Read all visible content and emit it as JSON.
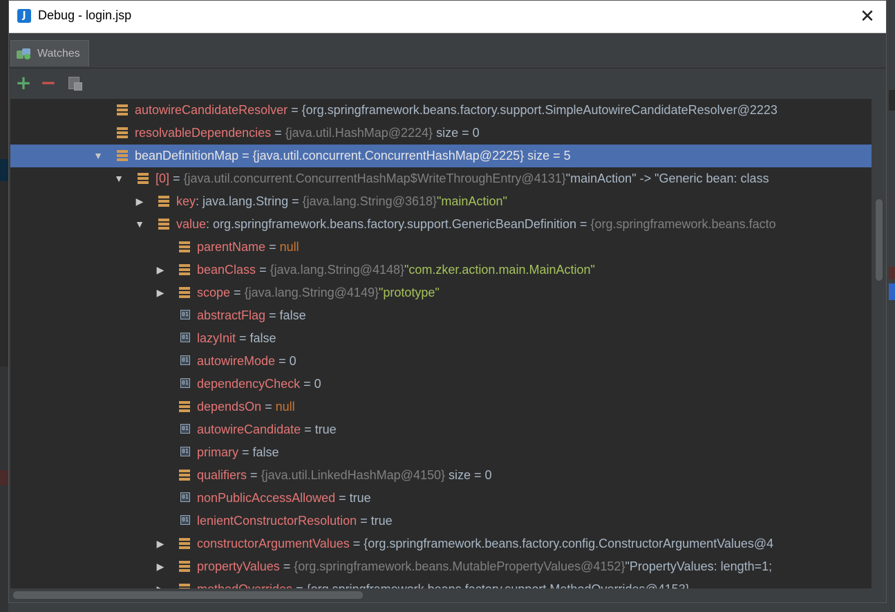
{
  "window": {
    "title": "Debug - login.jsp",
    "app_icon": "J",
    "close_glyph": "✕"
  },
  "tab": {
    "label": "Watches"
  },
  "toolbar": {
    "add": "+",
    "remove": "−"
  },
  "accent": "#4b6eaf",
  "rows": [
    {
      "indent": 0,
      "arrow": "",
      "icon": "field",
      "name": "autowireCandidateResolver",
      "parts": [
        {
          "c": "t",
          "text": " = "
        },
        {
          "c": "t",
          "text": "{org.springframework.beans.factory.support.SimpleAutowireCandidateResolver@2223"
        }
      ]
    },
    {
      "indent": 0,
      "arrow": "",
      "icon": "field",
      "name": "resolvableDependencies",
      "parts": [
        {
          "c": "t",
          "text": " = "
        },
        {
          "c": "g",
          "text": "{java.util.HashMap@2224}"
        },
        {
          "c": "t",
          "text": " size = 0"
        }
      ]
    },
    {
      "indent": 0,
      "arrow": "▼",
      "icon": "field",
      "selected": true,
      "name": "beanDefinitionMap",
      "parts": [
        {
          "c": "t",
          "text": " = "
        },
        {
          "c": "t",
          "text": "{java.util.concurrent.ConcurrentHashMap@2225}"
        },
        {
          "c": "t",
          "text": " size = 5"
        }
      ]
    },
    {
      "indent": 1,
      "arrow": "▼",
      "icon": "field",
      "name": "[0]",
      "parts": [
        {
          "c": "t",
          "text": " = "
        },
        {
          "c": "g",
          "text": "{java.util.concurrent.ConcurrentHashMap$WriteThroughEntry@4131}"
        },
        {
          "c": "t",
          "text": "\"mainAction\" -> \"Generic bean: class"
        }
      ]
    },
    {
      "indent": 2,
      "arrow": "▶",
      "icon": "field",
      "name": "key",
      "parts": [
        {
          "c": "t",
          "text": ": java.lang.String = "
        },
        {
          "c": "g",
          "text": "{java.lang.String@3618}"
        },
        {
          "c": "s",
          "text": "\"mainAction\""
        }
      ]
    },
    {
      "indent": 2,
      "arrow": "▼",
      "icon": "field",
      "name": "value",
      "parts": [
        {
          "c": "t",
          "text": ": org.springframework.beans.factory.support.GenericBeanDefinition = "
        },
        {
          "c": "g",
          "text": "{org.springframework.beans.facto"
        }
      ]
    },
    {
      "indent": 3,
      "arrow": "",
      "icon": "field",
      "name": "parentName",
      "parts": [
        {
          "c": "t",
          "text": " = "
        },
        {
          "c": "k",
          "text": "null"
        }
      ]
    },
    {
      "indent": 3,
      "arrow": "▶",
      "icon": "field",
      "name": "beanClass",
      "parts": [
        {
          "c": "t",
          "text": " = "
        },
        {
          "c": "g",
          "text": "{java.lang.String@4148}"
        },
        {
          "c": "s",
          "text": "\"com.zker.action.main.MainAction\""
        }
      ]
    },
    {
      "indent": 3,
      "arrow": "▶",
      "icon": "field",
      "name": "scope",
      "parts": [
        {
          "c": "t",
          "text": " = "
        },
        {
          "c": "g",
          "text": "{java.lang.String@4149}"
        },
        {
          "c": "s",
          "text": "\"prototype\""
        }
      ]
    },
    {
      "indent": 3,
      "arrow": "",
      "icon": "prim",
      "name": "abstractFlag",
      "parts": [
        {
          "c": "t",
          "text": " = false"
        }
      ]
    },
    {
      "indent": 3,
      "arrow": "",
      "icon": "prim",
      "name": "lazyInit",
      "parts": [
        {
          "c": "t",
          "text": " = false"
        }
      ]
    },
    {
      "indent": 3,
      "arrow": "",
      "icon": "prim",
      "name": "autowireMode",
      "parts": [
        {
          "c": "t",
          "text": " = 0"
        }
      ]
    },
    {
      "indent": 3,
      "arrow": "",
      "icon": "prim",
      "name": "dependencyCheck",
      "parts": [
        {
          "c": "t",
          "text": " = 0"
        }
      ]
    },
    {
      "indent": 3,
      "arrow": "",
      "icon": "field",
      "name": "dependsOn",
      "parts": [
        {
          "c": "t",
          "text": " = "
        },
        {
          "c": "k",
          "text": "null"
        }
      ]
    },
    {
      "indent": 3,
      "arrow": "",
      "icon": "prim",
      "name": "autowireCandidate",
      "parts": [
        {
          "c": "t",
          "text": " = true"
        }
      ]
    },
    {
      "indent": 3,
      "arrow": "",
      "icon": "prim",
      "name": "primary",
      "parts": [
        {
          "c": "t",
          "text": " = false"
        }
      ]
    },
    {
      "indent": 3,
      "arrow": "",
      "icon": "field",
      "name": "qualifiers",
      "parts": [
        {
          "c": "t",
          "text": " = "
        },
        {
          "c": "g",
          "text": "{java.util.LinkedHashMap@4150}"
        },
        {
          "c": "t",
          "text": " size = 0"
        }
      ]
    },
    {
      "indent": 3,
      "arrow": "",
      "icon": "prim",
      "name": "nonPublicAccessAllowed",
      "parts": [
        {
          "c": "t",
          "text": " = true"
        }
      ]
    },
    {
      "indent": 3,
      "arrow": "",
      "icon": "prim",
      "name": "lenientConstructorResolution",
      "parts": [
        {
          "c": "t",
          "text": " = true"
        }
      ]
    },
    {
      "indent": 3,
      "arrow": "▶",
      "icon": "field",
      "name": "constructorArgumentValues",
      "parts": [
        {
          "c": "t",
          "text": " = "
        },
        {
          "c": "t",
          "text": "{org.springframework.beans.factory.config.ConstructorArgumentValues@4"
        }
      ]
    },
    {
      "indent": 3,
      "arrow": "▶",
      "icon": "field",
      "name": "propertyValues",
      "parts": [
        {
          "c": "t",
          "text": " = "
        },
        {
          "c": "g",
          "text": "{org.springframework.beans.MutablePropertyValues@4152}"
        },
        {
          "c": "t",
          "text": "\"PropertyValues: length=1;"
        }
      ]
    },
    {
      "indent": 3,
      "arrow": "▶",
      "icon": "field",
      "name": "methodOverrides",
      "parts": [
        {
          "c": "t",
          "text": " = "
        },
        {
          "c": "t",
          "text": "{org.springframework.beans.factory.support.MethodOverrides@4153}"
        }
      ]
    }
  ]
}
